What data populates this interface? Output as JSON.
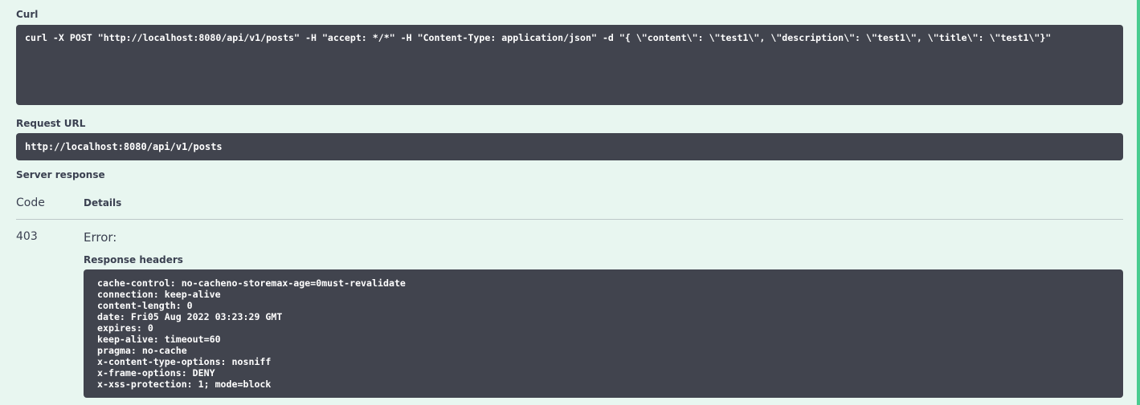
{
  "curl": {
    "label": "Curl",
    "command": "curl -X POST \"http://localhost:8080/api/v1/posts\" -H \"accept: */*\" -H \"Content-Type: application/json\" -d \"{ \\\"content\\\": \\\"test1\\\", \\\"description\\\": \\\"test1\\\", \\\"title\\\": \\\"test1\\\"}\""
  },
  "request_url": {
    "label": "Request URL",
    "value": "http://localhost:8080/api/v1/posts"
  },
  "server_response": {
    "label": "Server response",
    "code_header": "Code",
    "details_header": "Details",
    "code": "403",
    "error_text": "Error:",
    "response_headers_label": "Response headers",
    "headers": [
      "cache-control: no-cacheno-storemax-age=0must-revalidate",
      "connection: keep-alive",
      "content-length: 0",
      "date: Fri05 Aug 2022 03:23:29 GMT",
      "expires: 0",
      "keep-alive: timeout=60",
      "pragma: no-cache",
      "x-content-type-options: nosniff",
      "x-frame-options: DENY",
      "x-xss-protection: 1; mode=block"
    ]
  },
  "colors": {
    "background": "#e8f6f0",
    "code_block": "#41444e",
    "accent": "#49cc90",
    "text": "#3b4151"
  }
}
